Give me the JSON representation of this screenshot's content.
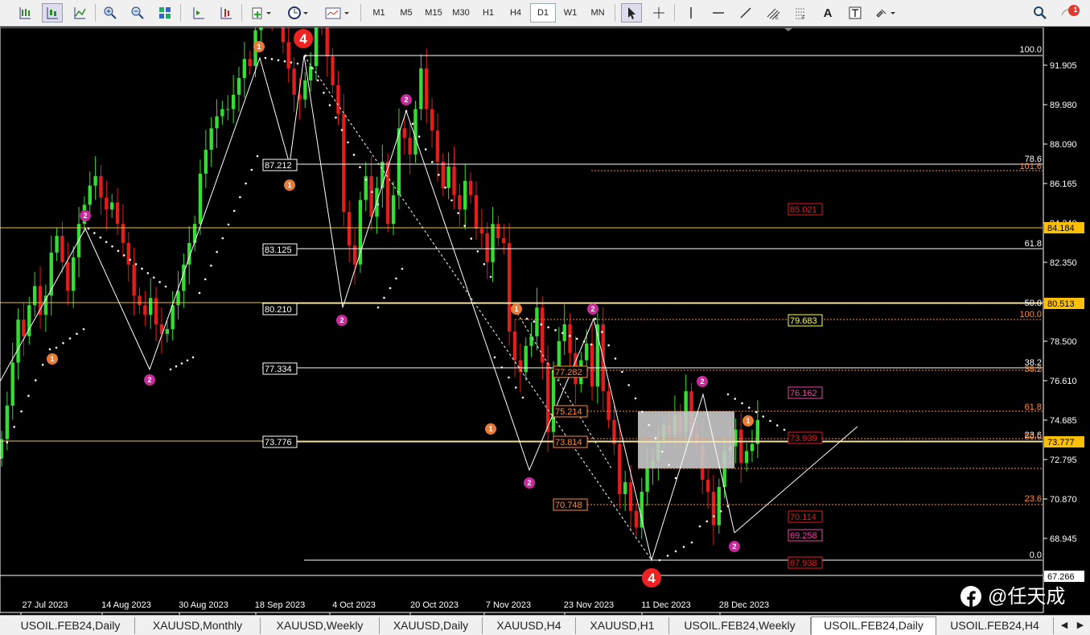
{
  "toolbar": {
    "timeframes": [
      "M1",
      "M5",
      "M15",
      "M30",
      "H1",
      "H4",
      "D1",
      "W1",
      "MN"
    ],
    "active_timeframe": "D1",
    "tool_letter": "A",
    "notification_count": "1"
  },
  "colors": {
    "bull": "#33dd33",
    "bear": "#e31c1c",
    "fibo_white": "#ffffff",
    "fibo_orange": "#ff8c3a",
    "fibo_yellow": "#ffff55",
    "fibo_magenta": "#ee44aa",
    "level_gold": "#e8c24a",
    "wave_orange": "#e87a38",
    "wave_magenta": "#c72a9a",
    "wave_red": "#ee2222"
  },
  "axis": {
    "price_ticks": [
      "91.905",
      "89.980",
      "88.090",
      "86.165",
      "84.240",
      "82.350",
      "80.425",
      "78.500",
      "76.610",
      "74.685",
      "72.795",
      "70.870",
      "68.945",
      "67.055"
    ],
    "date_ticks": [
      "27 Jul 2023",
      "14 Aug 2023",
      "30 Aug 2023",
      "18 Sep 2023",
      "4 Oct 2023",
      "20 Oct 2023",
      "7 Nov 2023",
      "23 Nov 2023",
      "11 Dec 2023",
      "28 Dec 2023"
    ],
    "price_tags": [
      {
        "text": "84.184",
        "kind": "gold"
      },
      {
        "text": "80.513",
        "kind": "gold"
      },
      {
        "text": "73.777",
        "kind": "gold"
      },
      {
        "text": "67.266",
        "kind": "white"
      }
    ]
  },
  "fibo_main": {
    "levels": [
      "100.0",
      "78.6",
      "61.8",
      "50.0",
      "38.2",
      "23.6",
      "0.0"
    ]
  },
  "fibo_prices": [
    "87.212",
    "83.125",
    "80.210",
    "77.334",
    "73.776"
  ],
  "fibo_ext": {
    "levels": [
      "101.6",
      "100.0",
      "38.2",
      "61.8",
      "50.0",
      "23.6"
    ]
  },
  "fibo_small_prices": [
    "77.282",
    "75.214",
    "73.814",
    "70.748"
  ],
  "right_prices": [
    {
      "text": "85.021",
      "kind": "red"
    },
    {
      "text": "79.683",
      "kind": "yellow"
    },
    {
      "text": "76.162",
      "kind": "magenta"
    },
    {
      "text": "73.939",
      "kind": "red"
    },
    {
      "text": "70.114",
      "kind": "red"
    },
    {
      "text": "69.258",
      "kind": "magenta"
    },
    {
      "text": "67.938",
      "kind": "red"
    }
  ],
  "wave_labels": [
    {
      "text": "1",
      "kind": "orange"
    },
    {
      "text": "4",
      "kind": "red"
    },
    {
      "text": "1",
      "kind": "orange"
    },
    {
      "text": "2",
      "kind": "magenta"
    },
    {
      "text": "2",
      "kind": "magenta"
    },
    {
      "text": "2",
      "kind": "magenta"
    },
    {
      "text": "1",
      "kind": "orange"
    },
    {
      "text": "2",
      "kind": "magenta"
    },
    {
      "text": "1",
      "kind": "orange"
    },
    {
      "text": "1",
      "kind": "orange"
    },
    {
      "text": "2",
      "kind": "magenta"
    },
    {
      "text": "2",
      "kind": "magenta"
    },
    {
      "text": "2",
      "kind": "magenta"
    },
    {
      "text": "1",
      "kind": "orange"
    },
    {
      "text": "2",
      "kind": "magenta"
    },
    {
      "text": "4",
      "kind": "red"
    }
  ],
  "watermark": "@任天成",
  "tabs": [
    "USOIL.FEB24,Daily",
    "XAUUSD,Monthly",
    "XAUUSD,Weekly",
    "XAUUSD,Daily",
    "XAUUSD,H4",
    "XAUUSD,H1",
    "USOIL.FEB24,Weekly",
    "USOIL.FEB24,Daily",
    "USOIL.FEB24,H4"
  ],
  "active_tab": 7,
  "chart_data": {
    "type": "candlestick",
    "symbol_tab": "USOIL.FEB24,Daily",
    "timeframe": "D1",
    "ylim": [
      66.9,
      93.4
    ],
    "x": [
      "27 Jul 2023",
      "14 Aug 2023",
      "30 Aug 2023",
      "18 Sep 2023",
      "4 Oct 2023",
      "20 Oct 2023",
      "7 Nov 2023",
      "23 Nov 2023",
      "11 Dec 2023",
      "28 Dec 2023"
    ],
    "close_path": [
      73.0,
      74.4,
      76.2,
      78.0,
      77.3,
      78.6,
      79.4,
      78.2,
      79.0,
      80.8,
      81.5,
      80.4,
      79.2,
      80.6,
      82.0,
      82.8,
      83.6,
      84.0,
      83.1,
      82.6,
      82.9,
      82.0,
      81.2,
      80.3,
      79.0,
      78.6,
      78.2,
      78.9,
      77.8,
      77.4,
      77.6,
      78.6,
      79.2,
      80.3,
      81.2,
      82.0,
      84.1,
      85.1,
      86.0,
      86.5,
      86.8,
      86.8,
      87.4,
      88.1,
      88.9,
      88.6,
      90.1,
      91.1,
      91.5,
      90.9,
      91.5,
      89.6,
      88.5,
      87.4,
      87.2,
      88.0,
      88.6,
      91.5,
      90.6,
      89.0,
      87.8,
      86.6,
      82.5,
      81.1,
      80.3,
      83.0,
      84.0,
      82.3,
      83.5,
      84.6,
      82.0,
      83.2,
      86.0,
      85.6,
      84.9,
      86.8,
      88.5,
      86.8,
      85.9,
      84.6,
      83.5,
      84.4,
      83.2,
      82.6,
      83.8,
      83.2,
      81.8,
      81.6,
      80.4,
      82.0,
      81.4,
      81.2,
      77.5,
      76.3,
      75.8,
      76.9,
      77.3,
      78.5,
      76.2,
      73.3,
      75.9,
      77.1,
      77.8,
      76.6,
      75.3,
      76.3,
      77.0,
      75.2,
      77.8,
      75.0,
      73.8,
      72.8,
      70.7,
      71.2,
      70.0,
      69.3,
      70.8,
      71.8,
      72.1,
      72.9,
      73.6,
      73.2,
      74.0,
      73.3,
      75.0,
      73.2,
      72.8,
      71.3,
      70.8,
      69.4,
      71.0,
      72.5,
      72.7,
      73.4,
      72.0,
      72.5,
      72.8,
      73.8
    ]
  }
}
